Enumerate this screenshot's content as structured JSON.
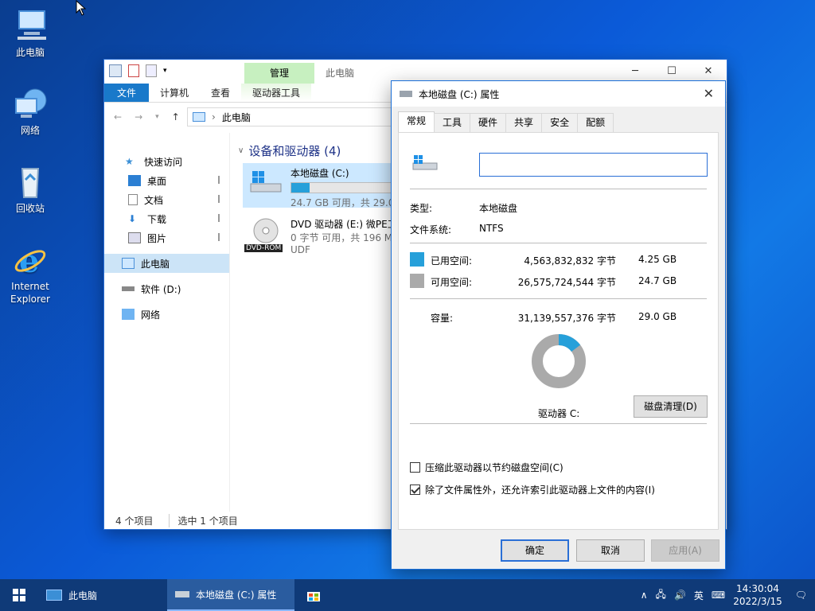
{
  "desktop": {
    "icons": [
      {
        "label": "此电脑"
      },
      {
        "label": "网络"
      },
      {
        "label": "回收站"
      },
      {
        "label": "Internet Explorer"
      }
    ]
  },
  "explorer": {
    "title_path": "此电脑",
    "context_tab": "管理",
    "ribbon_tabs": [
      "文件",
      "计算机",
      "查看",
      "驱动器工具"
    ],
    "address": "此电脑",
    "nav": [
      {
        "label": "快速访问"
      },
      {
        "label": "桌面"
      },
      {
        "label": "文档"
      },
      {
        "label": "下载"
      },
      {
        "label": "图片"
      },
      {
        "label": "此电脑"
      },
      {
        "label": "软件 (D:)"
      },
      {
        "label": "网络"
      }
    ],
    "group_header": "设备和驱动器 (4)",
    "drives": [
      {
        "name": "本地磁盘 (C:)",
        "info": "24.7 GB 可用，共 29.0",
        "used_fraction": 0.147
      },
      {
        "name": "DVD 驱动器 (E:) 微PE工",
        "info": "0 字节 可用，共 196 M",
        "fs": "UDF",
        "badge": "DVD-ROM"
      }
    ],
    "status": {
      "count": "4 个项目",
      "selected": "选中 1 个项目"
    }
  },
  "dialog": {
    "title": "本地磁盘 (C:) 属性",
    "tabs": [
      "常规",
      "工具",
      "硬件",
      "共享",
      "安全",
      "配额"
    ],
    "name_value": "",
    "type_label": "类型:",
    "type_value": "本地磁盘",
    "fs_label": "文件系统:",
    "fs_value": "NTFS",
    "used_label": "已用空间:",
    "used_bytes": "4,563,832,832 字节",
    "used_gb": "4.25 GB",
    "free_label": "可用空间:",
    "free_bytes": "26,575,724,544 字节",
    "free_gb": "24.7 GB",
    "cap_label": "容量:",
    "cap_bytes": "31,139,557,376 字节",
    "cap_gb": "29.0 GB",
    "used_fraction": 0.147,
    "drive_label": "驱动器 C:",
    "cleanup_btn": "磁盘清理(D)",
    "compress_label": "压缩此驱动器以节约磁盘空间(C)",
    "compress_checked": false,
    "index_label": "除了文件属性外，还允许索引此驱动器上文件的内容(I)",
    "index_checked": true,
    "ok": "确定",
    "cancel": "取消",
    "apply": "应用(A)",
    "colors": {
      "used": "#26a0da",
      "free": "#aaaaaa"
    }
  },
  "taskbar": {
    "items": [
      {
        "label": "此电脑"
      },
      {
        "label": "本地磁盘 (C:) 属性"
      }
    ],
    "ime": "英",
    "time": "14:30:04",
    "date": "2022/3/15"
  }
}
